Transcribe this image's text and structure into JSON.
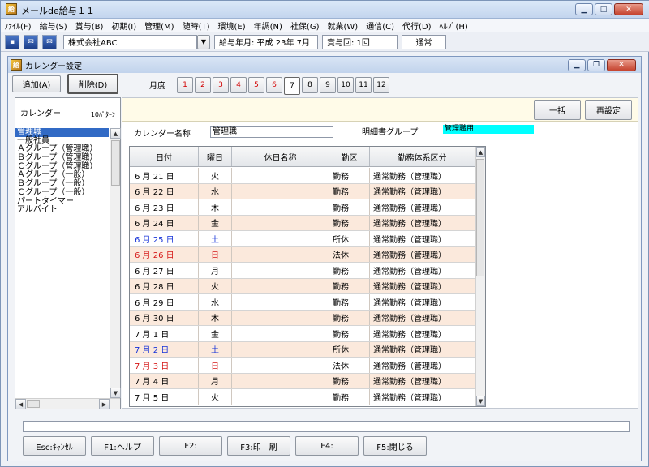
{
  "app": {
    "title": "メールde給与１１",
    "icon_text": "給"
  },
  "menu": [
    "ﾌｧｲﾙ(F)",
    "給与(S)",
    "賞与(B)",
    "初期(I)",
    "管理(M)",
    "随時(T)",
    "環境(E)",
    "年調(N)",
    "社保(G)",
    "就業(W)",
    "通信(C)",
    "代行(D)",
    "ﾍﾙﾌﾟ(H)"
  ],
  "toolbar": {
    "company": "株式会社ABC",
    "payroll_month": "給与年月: 平成 23年  7月",
    "bonus_count": "賞与回: 1回",
    "mode": "通常"
  },
  "window": {
    "title": "カレンダー設定",
    "icon_text": "給"
  },
  "controls": {
    "add_label": "追加(A)",
    "delete_label": "削除(D)",
    "month_label": "月度",
    "months": [
      "1",
      "2",
      "3",
      "4",
      "5",
      "6",
      "7",
      "8",
      "9",
      "10",
      "11",
      "12"
    ],
    "months_red": [
      1,
      2,
      3,
      4,
      5,
      6
    ],
    "selected_month": "7"
  },
  "left": {
    "header": "カレンダー",
    "count": "10ﾊﾟﾀｰﾝ",
    "items": [
      "管理職",
      "一般社員",
      "Ａグループ（管理職）",
      "Ｂグループ（管理職）",
      "Ｃグループ（管理職）",
      "Ａグループ（一般）",
      "Ｂグループ（一般）",
      "Ｃグループ（一般）",
      "パートタイマー",
      "アルバイト"
    ],
    "selected": 0
  },
  "right": {
    "buttons": {
      "bulk": "一括",
      "reset": "再設定"
    },
    "calendar_name_label": "カレンダー名称",
    "calendar_name_value": "管理職",
    "slip_group_label": "明細書グループ",
    "slip_group_value": "管理職用",
    "slip_group_color": "#00ffff"
  },
  "table": {
    "headers": [
      "日付",
      "曜日",
      "休日名称",
      "勤区",
      "勤務体系区分"
    ],
    "rows": [
      {
        "date": "6 月 21 日",
        "wd": "火",
        "holiday": "",
        "kind": "勤務",
        "system": "通常勤務（管理職）",
        "color": ""
      },
      {
        "date": "6 月 22 日",
        "wd": "水",
        "holiday": "",
        "kind": "勤務",
        "system": "通常勤務（管理職）",
        "color": ""
      },
      {
        "date": "6 月 23 日",
        "wd": "木",
        "holiday": "",
        "kind": "勤務",
        "system": "通常勤務（管理職）",
        "color": ""
      },
      {
        "date": "6 月 24 日",
        "wd": "金",
        "holiday": "",
        "kind": "勤務",
        "system": "通常勤務（管理職）",
        "color": ""
      },
      {
        "date": "6 月 25 日",
        "wd": "土",
        "holiday": "",
        "kind": "所休",
        "system": "通常勤務（管理職）",
        "color": "blue"
      },
      {
        "date": "6 月 26 日",
        "wd": "日",
        "holiday": "",
        "kind": "法休",
        "system": "通常勤務（管理職）",
        "color": "red"
      },
      {
        "date": "6 月 27 日",
        "wd": "月",
        "holiday": "",
        "kind": "勤務",
        "system": "通常勤務（管理職）",
        "color": ""
      },
      {
        "date": "6 月 28 日",
        "wd": "火",
        "holiday": "",
        "kind": "勤務",
        "system": "通常勤務（管理職）",
        "color": ""
      },
      {
        "date": "6 月 29 日",
        "wd": "水",
        "holiday": "",
        "kind": "勤務",
        "system": "通常勤務（管理職）",
        "color": ""
      },
      {
        "date": "6 月 30 日",
        "wd": "木",
        "holiday": "",
        "kind": "勤務",
        "system": "通常勤務（管理職）",
        "color": ""
      },
      {
        "date": "7 月  1 日",
        "wd": "金",
        "holiday": "",
        "kind": "勤務",
        "system": "通常勤務（管理職）",
        "color": ""
      },
      {
        "date": "7 月  2 日",
        "wd": "土",
        "holiday": "",
        "kind": "所休",
        "system": "通常勤務（管理職）",
        "color": "blue"
      },
      {
        "date": "7 月  3 日",
        "wd": "日",
        "holiday": "",
        "kind": "法休",
        "system": "通常勤務（管理職）",
        "color": "red"
      },
      {
        "date": "7 月  4 日",
        "wd": "月",
        "holiday": "",
        "kind": "勤務",
        "system": "通常勤務（管理職）",
        "color": ""
      },
      {
        "date": "7 月  5 日",
        "wd": "火",
        "holiday": "",
        "kind": "勤務",
        "system": "通常勤務（管理職）",
        "color": ""
      }
    ]
  },
  "fkeys": [
    "Esc:ｷｬﾝｾﾙ",
    "F1:ヘルプ",
    "F2:",
    "F3:印　刷",
    "F4:",
    "F5:閉じる"
  ]
}
